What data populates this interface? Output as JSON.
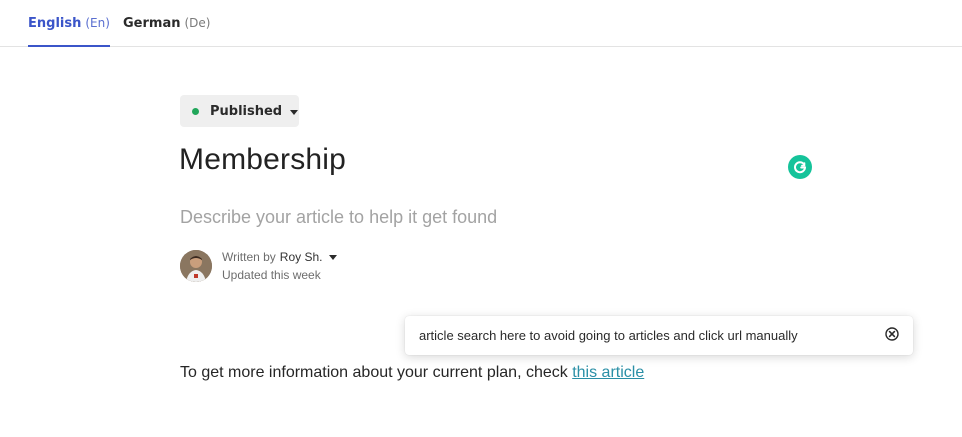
{
  "tabs": [
    {
      "name": "English",
      "code": "(En)",
      "active": true
    },
    {
      "name": "German",
      "code": "(De)",
      "active": false
    }
  ],
  "status": {
    "label": "Published",
    "color": "#21a65a"
  },
  "article": {
    "title": "Membership",
    "description_placeholder": "Describe your article to help it get found"
  },
  "author": {
    "prefix": "Written by",
    "name": "Roy Sh.",
    "updated": "Updated this week"
  },
  "note": {
    "text": "article search here to avoid going to articles and click url manually"
  },
  "body": {
    "text": "To get more information about your current plan, check ",
    "link_text": "this article"
  },
  "icons": {
    "grammarly": "grammarly-icon",
    "close": "close-circle-icon",
    "status_dropdown": "chevron-down-icon",
    "author_dropdown": "chevron-down-icon"
  },
  "colors": {
    "accent": "#3b55c9",
    "link": "#2a8fa6",
    "grammarly": "#15c39a"
  }
}
